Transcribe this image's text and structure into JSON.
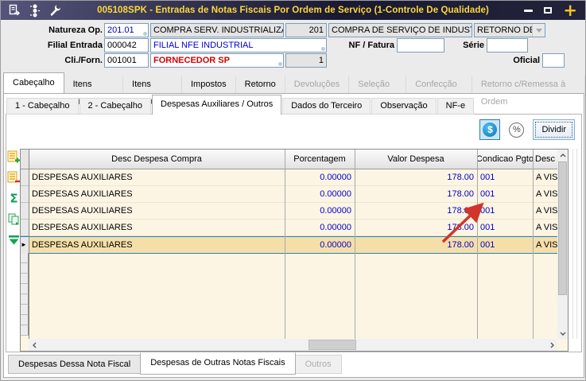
{
  "titlebar": {
    "title": "005108SPK - Entradas de Notas Fiscais Por Ordem de Serviço (1-Controle De Qualidade)",
    "icons": [
      "document-icon",
      "traffic-light-icon",
      "wrench-icon"
    ],
    "controls": {
      "close_label": "+"
    }
  },
  "form": {
    "natureza": {
      "label": "Natureza Op.",
      "code": "201.01",
      "desc": "COMPRA SERV. INDUSTRIALIZADO",
      "group_code": "201",
      "group_desc": "COMPRA DE SERVIÇO DE INDUSTRIAL",
      "tipo": "RETORNO DE MERCAD"
    },
    "filial": {
      "label": "Filial Entrada",
      "code": "000042",
      "desc": "FILIAL NFE INDUSTRIAL"
    },
    "nf": {
      "label": "NF / Fatura",
      "value": ""
    },
    "serie": {
      "label": "Série",
      "value": ""
    },
    "fornecedor": {
      "label": "Cli./Forn.",
      "code": "001001",
      "desc": "FORNECEDOR SP",
      "loja": "1"
    },
    "oficial": {
      "label": "Oficial",
      "value": ""
    }
  },
  "main_tabs": [
    {
      "label": "Cabeçalho",
      "active": true,
      "enabled": true
    },
    {
      "label": "Itens Físicos",
      "active": false,
      "enabled": true
    },
    {
      "label": "Itens Fiscais",
      "active": false,
      "enabled": true
    },
    {
      "label": "Impostos",
      "active": false,
      "enabled": true
    },
    {
      "label": "Retorno",
      "active": false,
      "enabled": true
    },
    {
      "label": "Devoluções",
      "active": false,
      "enabled": false
    },
    {
      "label": "Seleção OS",
      "active": false,
      "enabled": false
    },
    {
      "label": "Confecção OS",
      "active": false,
      "enabled": false
    },
    {
      "label": "Retorno c/Remessa à Ordem",
      "active": false,
      "enabled": false
    }
  ],
  "sub_tabs": [
    {
      "label": "1 - Cabeçalho",
      "active": false
    },
    {
      "label": "2 - Cabeçalho",
      "active": false
    },
    {
      "label": "Despesas Auxiliares / Outros",
      "active": true
    },
    {
      "label": "Dados do Terceiro",
      "active": false
    },
    {
      "label": "Observação",
      "active": false
    },
    {
      "label": "NF-e",
      "active": false
    }
  ],
  "toolbar": {
    "money_label": "$",
    "percent_label": "%",
    "dividir_label": "Dividir"
  },
  "side_icons": [
    "add-row-icon",
    "delete-row-icon",
    "sum-icon",
    "copy-rows-icon",
    "go-to-last-icon"
  ],
  "grid": {
    "columns": [
      "Desc Despesa Compra",
      "Porcentagem",
      "Valor Despesa",
      "Condicao Pgto",
      "Desc C"
    ],
    "rows": [
      {
        "desc": "DESPESAS AUXILIARES",
        "porcentagem": "0.00000",
        "valor": "178.00",
        "condicao": "001",
        "cond_desc": "A VISTA"
      },
      {
        "desc": "DESPESAS AUXILIARES",
        "porcentagem": "0.00000",
        "valor": "178.00",
        "condicao": "001",
        "cond_desc": "A VISTA"
      },
      {
        "desc": "DESPESAS AUXILIARES",
        "porcentagem": "0.00000",
        "valor": "178.00",
        "condicao": "001",
        "cond_desc": "A VISTA"
      },
      {
        "desc": "DESPESAS AUXILIARES",
        "porcentagem": "0.00000",
        "valor": "178.00",
        "condicao": "001",
        "cond_desc": "A VISTA"
      },
      {
        "desc": "DESPESAS AUXILIARES",
        "porcentagem": "0.00000",
        "valor": "178.00",
        "condicao": "001",
        "cond_desc": "A VISTA"
      }
    ],
    "selected_row_index": 4,
    "selected_row_marker": "►"
  },
  "bottom_tabs": [
    {
      "label": "Despesas Dessa Nota Fiscal",
      "active": false,
      "enabled": true
    },
    {
      "label": "Despesas de Outras Notas Fiscais",
      "active": true,
      "enabled": true
    },
    {
      "label": "Outros",
      "active": false,
      "enabled": false
    }
  ],
  "annotation": {
    "type": "red-arrow",
    "points_at": "Valor Despesa 178.00 (linha 3)",
    "color": "#D2342A"
  },
  "colors": {
    "titlebar_bg": "#23233C",
    "title_text": "#FFD83A",
    "grid_row_bg": "#FCF5E4",
    "selected_row_bg": "#F5DFA9",
    "selected_row_border": "#2E7FBE",
    "value_blue": "#0000CC",
    "supplier_red": "#D40000",
    "money_button_blue": "#1274B5"
  }
}
